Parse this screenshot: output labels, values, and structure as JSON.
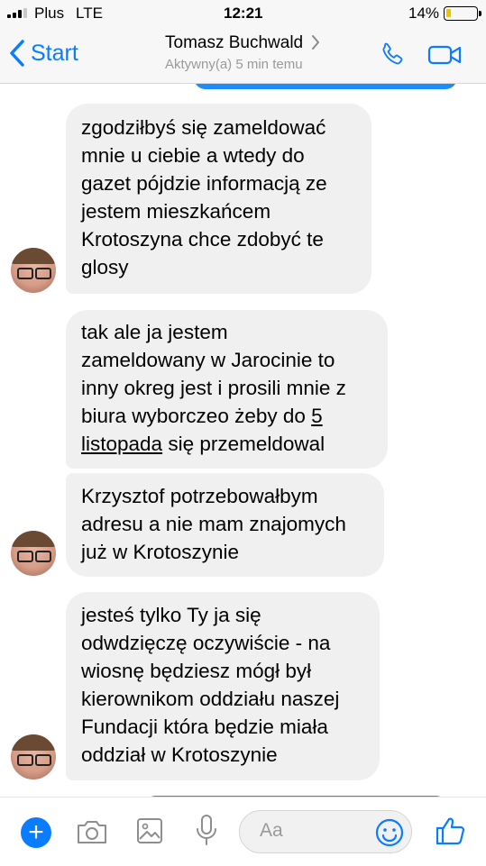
{
  "status_bar": {
    "carrier": "Plus",
    "network": "LTE",
    "time": "12:21",
    "battery_text": "14%",
    "battery_level": 0.14,
    "battery_color": "#f3c300"
  },
  "nav": {
    "back_label": "Start",
    "contact_name": "Tomasz Buchwald",
    "presence": "Aktywny(a) 5 min temu",
    "accent_color": "#0a7cff",
    "icons": [
      "chevron-left-icon",
      "chevron-right-icon",
      "phone-icon",
      "video-camera-icon"
    ]
  },
  "messages": [
    {
      "direction": "incoming",
      "text": "zgodziłbyś się  zameldować\nmnie u ciebie a wtedy do\ngazet pójdzie informacją ze\njestem mieszkańcem\nKrotoszyna chce zdobyć te\nglosy",
      "has_avatar": true
    },
    {
      "direction": "incoming",
      "text_before": "tak ale ja jestem\nzameldowany w Jarocinie to\ninny okreg jest i prosili mnie z\nbiura wyborczeo żeby do ",
      "link": "5\nlistopada",
      "text_after": " się przemeldowal",
      "has_avatar": false
    },
    {
      "direction": "incoming",
      "text": "Krzysztof potrzebowałbym\nadresu a nie mam znajomych\njuż w Krotoszynie",
      "has_avatar": true
    },
    {
      "direction": "incoming",
      "text": "jesteś tylko Ty  ja się\nodwdzięczę oczywiście - na\nwiosnę będziesz mógł był\nkierownikom oddziału naszej\nFundacji która  będzie miała\noddział w Krotoszynie",
      "has_avatar": true
    }
  ],
  "bubble_color_incoming": "#f0f0f0",
  "bubble_color_outgoing": "#1a8cff",
  "composer": {
    "placeholder": "Aa",
    "icons": [
      "plus-icon",
      "camera-icon",
      "image-icon",
      "microphone-icon",
      "emoji-icon",
      "thumbs-up-icon"
    ]
  }
}
